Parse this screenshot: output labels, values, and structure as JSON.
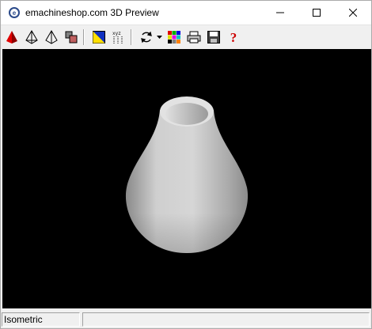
{
  "window": {
    "title": "emachineshop.com 3D Preview"
  },
  "toolbar": {
    "icons": [
      "render-solid-icon",
      "wireframe-icon",
      "wireframe-hidden-icon",
      "parts-icon",
      "colors-icon",
      "xyz-axes-icon",
      "rotate-icon",
      "rotate-dropdown-icon",
      "palette-icon",
      "print-icon",
      "save-icon",
      "help-icon"
    ]
  },
  "statusbar": {
    "view_mode": "Isometric",
    "secondary": ""
  },
  "colors": {
    "viewport_bg": "#000000",
    "part": "#c8c8c8",
    "help": "#cc0000",
    "render": "#cc0000"
  }
}
